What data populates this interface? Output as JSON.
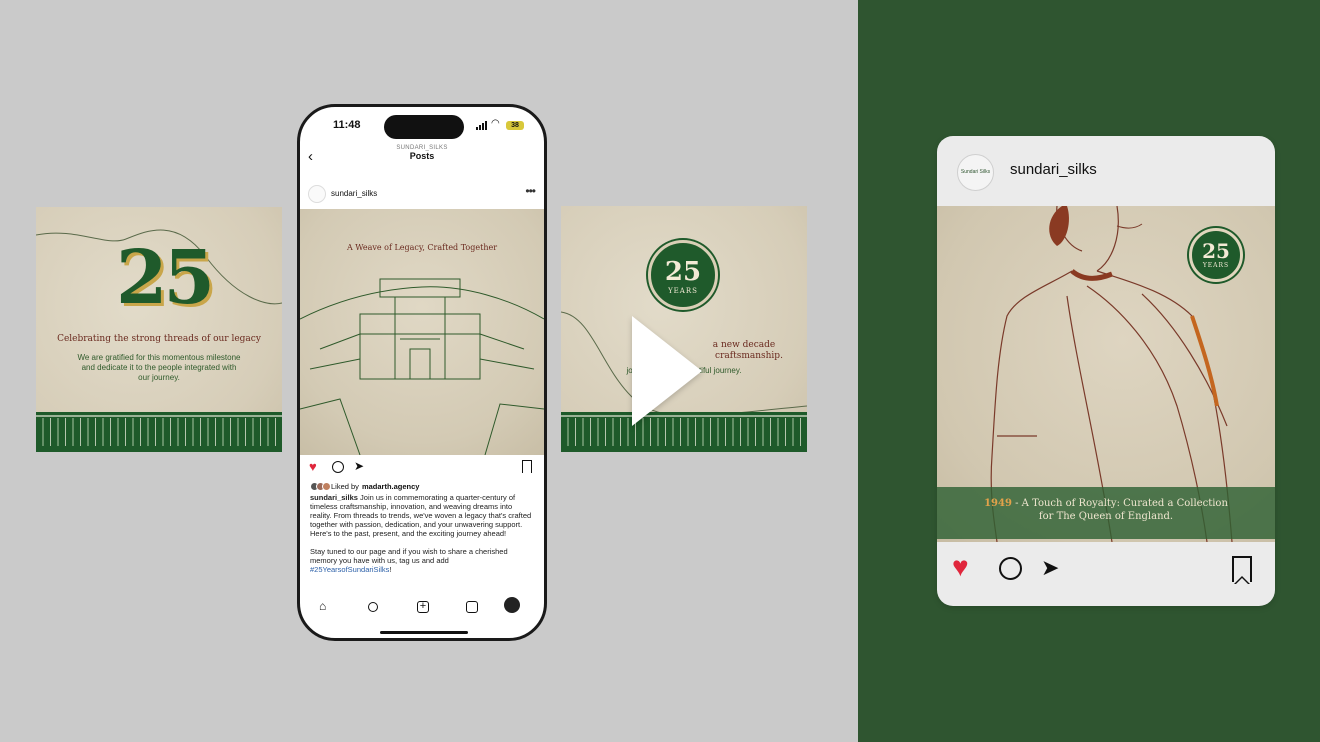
{
  "left_card": {
    "number": "25",
    "heading": "Celebrating the strong threads of our legacy",
    "body": "We are gratified for this momentous milestone and dedicate it to the people integrated with our journey."
  },
  "right_card": {
    "seal_number": "25",
    "seal_label": "YEARS",
    "fragment_line1": "a new decade",
    "fragment_line2": "craftsmanship.",
    "fragment_body": "join u                    autiful journey."
  },
  "phone": {
    "status": {
      "time": "11:48",
      "battery": "38"
    },
    "header": {
      "subtitle": "SUNDARI_SILKS",
      "title": "Posts"
    },
    "post": {
      "username": "sundari_silks",
      "image_title": "A Weave of Legacy, Crafted Together",
      "liked_by_prefix": "Liked by ",
      "liked_by_user": "madarth.agency",
      "caption_user": "sundari_silks",
      "caption_text": " Join us in commemorating a quarter-century of timeless craftsmanship, innovation, and weaving dreams into reality. From threads to trends, we've woven a legacy that's crafted together with passion, dedication, and your unwavering support. Here's to the past, present, and the exciting journey ahead!",
      "caption_text2": "Stay tuned to our page and if you wish to share a cherished memory you have with us, tag us and add",
      "hashtag": "#25YearsofSundariSilks",
      "hashtag_suffix": "!"
    }
  },
  "ig_card": {
    "username": "sundari_silks",
    "avatar_text": "Sundari Silks",
    "seal_number": "25",
    "seal_label": "YEARS",
    "caption_year": "1949",
    "caption_line1": " - A Touch of Royalty: Curated a Collection",
    "caption_line2": "for The Queen of England."
  },
  "colors": {
    "left_bg": "#cacaca",
    "right_bg": "#2f5530",
    "brand_green": "#1f5a2b",
    "accent_red": "#e0263c",
    "maroon": "#6a2a1f"
  }
}
